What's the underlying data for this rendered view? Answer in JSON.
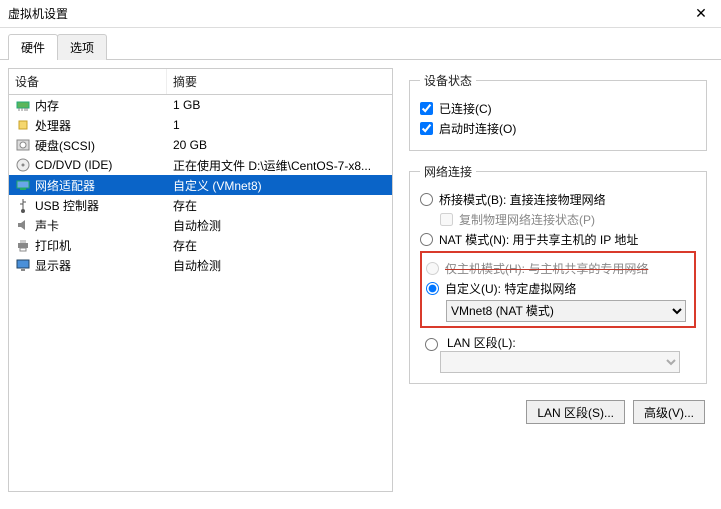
{
  "window": {
    "title": "虚拟机设置",
    "close": "✕"
  },
  "tabs": {
    "hardware": "硬件",
    "options": "选项"
  },
  "left": {
    "head_device": "设备",
    "head_summary": "摘要",
    "rows": [
      {
        "icon": "memory",
        "name": "内存",
        "summary": "1 GB"
      },
      {
        "icon": "cpu",
        "name": "处理器",
        "summary": "1"
      },
      {
        "icon": "disk",
        "name": "硬盘(SCSI)",
        "summary": "20 GB"
      },
      {
        "icon": "cd",
        "name": "CD/DVD (IDE)",
        "summary": "正在使用文件 D:\\运维\\CentOS-7-x8..."
      },
      {
        "icon": "net",
        "name": "网络适配器",
        "summary": "自定义 (VMnet8)",
        "selected": true
      },
      {
        "icon": "usb",
        "name": "USB 控制器",
        "summary": "存在"
      },
      {
        "icon": "sound",
        "name": "声卡",
        "summary": "自动检测"
      },
      {
        "icon": "printer",
        "name": "打印机",
        "summary": "存在"
      },
      {
        "icon": "display",
        "name": "显示器",
        "summary": "自动检测"
      }
    ]
  },
  "right": {
    "status_legend": "设备状态",
    "connected": "已连接(C)",
    "connect_on": "启动时连接(O)",
    "net_legend": "网络连接",
    "bridged": "桥接模式(B): 直接连接物理网络",
    "replicate": "复制物理网络连接状态(P)",
    "nat": "NAT 模式(N): 用于共享主机的 IP 地址",
    "hostonly": "仅主机模式(H): 与主机共享的专用网络",
    "custom": "自定义(U): 特定虚拟网络",
    "custom_value": "VMnet8 (NAT 模式)",
    "lanseg": "LAN 区段(L):",
    "btn_lan": "LAN 区段(S)...",
    "btn_adv": "高级(V)..."
  }
}
